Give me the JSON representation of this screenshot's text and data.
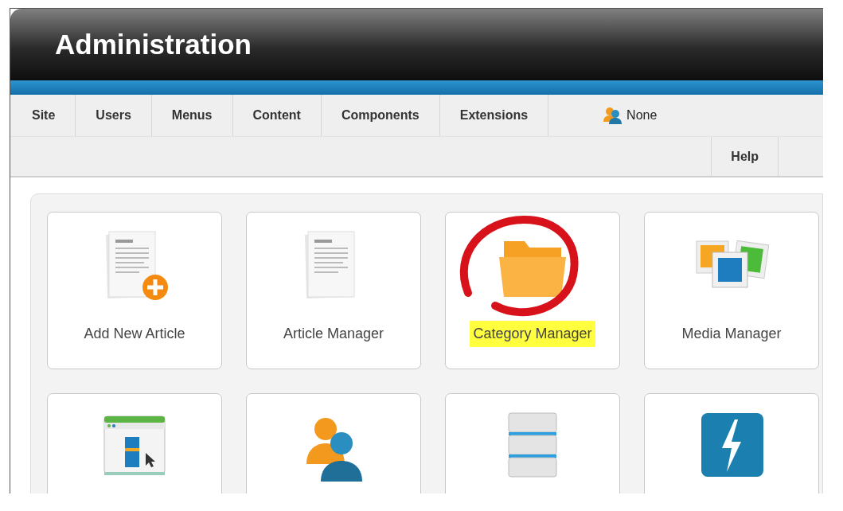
{
  "header": {
    "title": "Administration"
  },
  "menu": {
    "tabs": [
      {
        "label": "Site"
      },
      {
        "label": "Users"
      },
      {
        "label": "Menus"
      },
      {
        "label": "Content"
      },
      {
        "label": "Components"
      },
      {
        "label": "Extensions"
      }
    ],
    "user": {
      "label": "None"
    },
    "second_row": [
      {
        "label": "Help"
      }
    ]
  },
  "quick_icons": [
    {
      "kind": "add-article",
      "label": "Add New Article",
      "highlighted": false,
      "circled": false
    },
    {
      "kind": "article",
      "label": "Article Manager",
      "highlighted": false,
      "circled": false
    },
    {
      "kind": "folder",
      "label": "Category Manager",
      "highlighted": true,
      "circled": true
    },
    {
      "kind": "media",
      "label": "Media Manager",
      "highlighted": false,
      "circled": false
    },
    {
      "kind": "template",
      "circled": false
    },
    {
      "kind": "users",
      "circled": false
    },
    {
      "kind": "database",
      "circled": false
    },
    {
      "kind": "flash",
      "circled": false
    }
  ]
}
